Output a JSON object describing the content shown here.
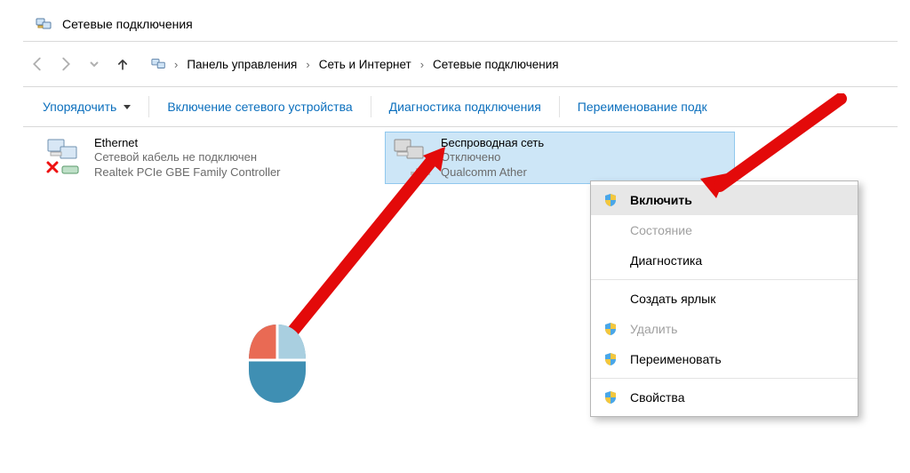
{
  "window": {
    "title": "Сетевые подключения"
  },
  "breadcrumb": {
    "items": [
      "Панель управления",
      "Сеть и Интернет",
      "Сетевые подключения"
    ]
  },
  "commands": {
    "organize": "Упорядочить",
    "enable_device": "Включение сетевого устройства",
    "diagnose": "Диагностика подключения",
    "rename": "Переименование подк"
  },
  "adapters": [
    {
      "name": "Ethernet",
      "status": "Сетевой кабель не подключен",
      "detail": "Realtek PCIe GBE Family Controller",
      "selected": false
    },
    {
      "name": "Беспроводная сеть",
      "status": "Отключено",
      "detail": "Qualcomm Ather",
      "selected": true
    }
  ],
  "context_menu": {
    "items": [
      {
        "label": "Включить",
        "shield": true,
        "enabled": true,
        "hover": true
      },
      {
        "label": "Состояние",
        "shield": false,
        "enabled": false,
        "hover": false
      },
      {
        "label": "Диагностика",
        "shield": false,
        "enabled": true,
        "hover": false
      },
      {
        "sep": true
      },
      {
        "label": "Создать ярлык",
        "shield": false,
        "enabled": true,
        "hover": false
      },
      {
        "label": "Удалить",
        "shield": true,
        "enabled": false,
        "hover": false
      },
      {
        "label": "Переименовать",
        "shield": true,
        "enabled": true,
        "hover": false
      },
      {
        "sep": true
      },
      {
        "label": "Свойства",
        "shield": true,
        "enabled": true,
        "hover": false
      }
    ]
  }
}
